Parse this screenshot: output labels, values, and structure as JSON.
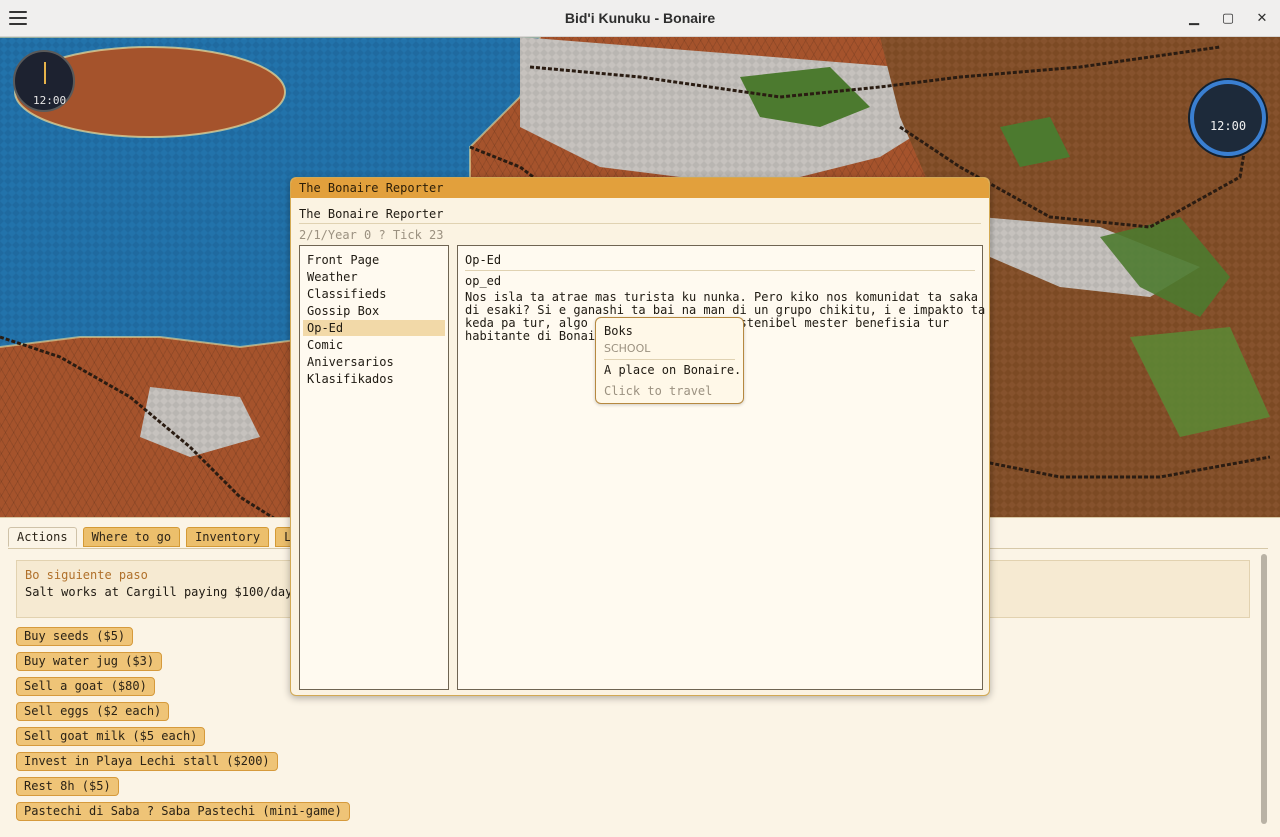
{
  "window": {
    "title": "Bid'i Kunuku - Bonaire",
    "minimize": "▁",
    "maximize": "▢",
    "close": "✕"
  },
  "map": {
    "clock_left": "12:00",
    "clock_right": "12:00",
    "colors": {
      "sea": "#1f6aa0",
      "land": "#a5532c",
      "road": "#bdb8b0",
      "green": "#4c7a2f"
    }
  },
  "tabs": [
    {
      "label": "Actions",
      "active": true
    },
    {
      "label": "Where to go"
    },
    {
      "label": "Inventory"
    },
    {
      "label": "Log"
    }
  ],
  "next_step": {
    "label": "Bo siguiente paso",
    "text": "Salt works at Cargill paying $100/day."
  },
  "actions": [
    {
      "label": "Buy seeds ($5)"
    },
    {
      "label": "Buy water jug ($3)"
    },
    {
      "label": "Sell a goat ($80)"
    },
    {
      "label": "Sell eggs ($2 each)"
    },
    {
      "label": "Sell goat milk ($5 each)"
    },
    {
      "label": "Invest in Playa Lechi stall ($200)"
    },
    {
      "label": "Rest 8h ($5)"
    },
    {
      "label": "Pastechi di Saba ? Saba Pastechi (mini-game)"
    }
  ],
  "reporter": {
    "title": "The Bonaire Reporter",
    "heading": "The Bonaire Reporter",
    "date": "2/1/Year 0 ? Tick 23",
    "sections": [
      {
        "label": "Front Page"
      },
      {
        "label": "Weather"
      },
      {
        "label": "Classifieds"
      },
      {
        "label": "Gossip Box"
      },
      {
        "label": "Op-Ed",
        "selected": true
      },
      {
        "label": "Comic"
      },
      {
        "label": "Aniversarios"
      },
      {
        "label": "Klasifikados"
      }
    ],
    "article": {
      "header": "Op-Ed",
      "key": "op_ed",
      "body": "Nos isla ta atrae mas turista ku nunka. Pero kiko nos komunidat ta saka\ndi esaki? Si e ganashi ta bai na man di un grupo chikitu, i e impakto ta\nkeda pa tur, algo ta mal. E turismo sostenibel mester benefisia tur\nhabitante di Bonaire."
    }
  },
  "tooltip": {
    "name": "Boks",
    "type": "SCHOOL",
    "description": "A place on Bonaire.",
    "hint": "Click to travel"
  }
}
